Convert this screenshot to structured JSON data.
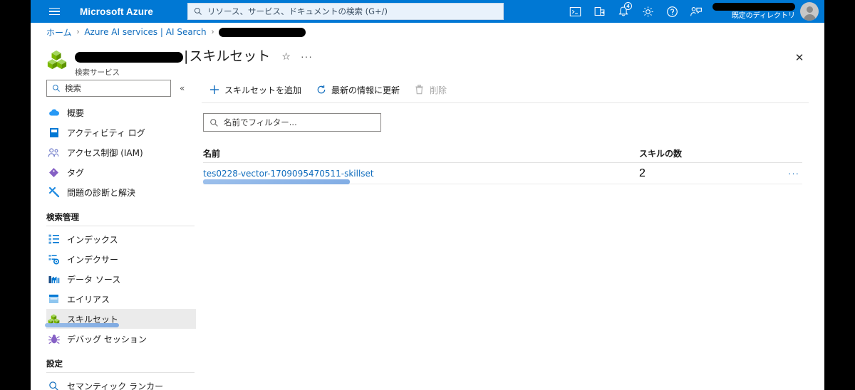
{
  "topnav": {
    "menu_icon": "hamburger-icon",
    "brand": "Microsoft Azure",
    "search_placeholder": "リソース、サービス、ドキュメントの検索 (G+/)",
    "icons": [
      {
        "name": "cloud-shell-icon",
        "glyph": ">_"
      },
      {
        "name": "directory-switch-icon",
        "glyph": "directory"
      },
      {
        "name": "notifications-icon",
        "glyph": "bell",
        "badge": "4"
      },
      {
        "name": "settings-gear-icon",
        "glyph": "gear"
      },
      {
        "name": "help-icon",
        "glyph": "?"
      },
      {
        "name": "feedback-icon",
        "glyph": "feedback"
      }
    ],
    "user": {
      "name_redacted": true,
      "directory": "既定のディレクトリ"
    }
  },
  "breadcrumb": {
    "items": [
      {
        "label": "ホーム",
        "link": true
      },
      {
        "label": "Azure AI services | AI Search",
        "link": true
      }
    ],
    "redacted_tail": true,
    "separator": "›"
  },
  "page": {
    "resource_icon": "search-service-cubes-icon",
    "title_redacted": true,
    "title_separator": "|",
    "title": "スキルセット",
    "subtitle": "検索サービス",
    "favorite_icon": "☆",
    "more_icon": "···",
    "close_icon": "✕"
  },
  "sidebar": {
    "search_placeholder": "検索",
    "collapse_icon": "«",
    "items": [
      {
        "label": "概要",
        "icon": "cloud-icon",
        "selected": false
      },
      {
        "label": "アクティビティ ログ",
        "icon": "activity-log-icon",
        "selected": false
      },
      {
        "label": "アクセス制御 (IAM)",
        "icon": "access-control-icon",
        "selected": false
      },
      {
        "label": "タグ",
        "icon": "tag-icon",
        "selected": false
      },
      {
        "label": "問題の診断と解決",
        "icon": "diagnose-wrench-icon",
        "selected": false
      }
    ],
    "groups": [
      {
        "title": "検索管理",
        "items": [
          {
            "label": "インデックス",
            "icon": "index-list-icon",
            "selected": false
          },
          {
            "label": "インデクサー",
            "icon": "indexer-gear-icon",
            "selected": false
          },
          {
            "label": "データ ソース",
            "icon": "data-source-icon",
            "selected": false
          },
          {
            "label": "エイリアス",
            "icon": "alias-icon",
            "selected": false
          },
          {
            "label": "スキルセット",
            "icon": "skillset-cubes-icon",
            "selected": true
          },
          {
            "label": "デバッグ セッション",
            "icon": "debug-bug-icon",
            "selected": false
          }
        ]
      },
      {
        "title": "設定",
        "items": [
          {
            "label": "セマンティック ランカー",
            "icon": "semantic-ranker-icon",
            "selected": false
          }
        ]
      }
    ]
  },
  "toolbar": {
    "add_label": "スキルセットを追加",
    "add_icon": "+",
    "refresh_label": "最新の情報に更新",
    "refresh_icon": "refresh-icon",
    "delete_label": "削除",
    "delete_icon": "trash-icon",
    "delete_disabled": true
  },
  "filter": {
    "placeholder": "名前でフィルター...",
    "icon": "search-icon"
  },
  "table": {
    "columns": [
      {
        "key": "name",
        "label": "名前"
      },
      {
        "key": "count",
        "label": "スキルの数"
      }
    ],
    "rows": [
      {
        "name": "tes0228-vector-1709095470511-skillset",
        "count": "2",
        "row_menu_icon": "···"
      }
    ]
  },
  "annotations": {
    "highlight_color": "#7ba7de",
    "marks": [
      {
        "target": "sidebar-item-skillsets"
      },
      {
        "target": "table-row-name-link"
      }
    ]
  }
}
